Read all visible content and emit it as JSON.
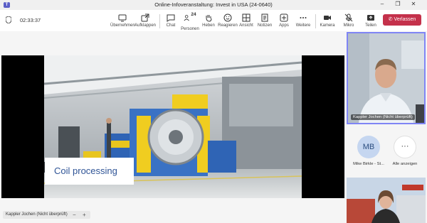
{
  "window": {
    "title": "Online-Infoveranstaltung: Invest in USA (24-0640)"
  },
  "meeting": {
    "timer": "02:33:37"
  },
  "toolbar": {
    "uebernehmen": "Übernehmen",
    "aufklappen": "Aufklappen",
    "chat": "Chat",
    "personen": "Personen",
    "personen_count": "24",
    "heben": "Heben",
    "reagieren": "Reagieren",
    "ansicht": "Ansicht",
    "notizen": "Notizen",
    "apps": "Apps",
    "weitere": "Weitere",
    "kamera": "Kamera",
    "mikro": "Mikro",
    "teilen": "Teilen",
    "verlassen": "Verlassen"
  },
  "stage": {
    "slide_title": "Coil processing",
    "presenter_label": "Kappler Jochen (Nicht überprüft)",
    "zoom_out": "−",
    "zoom_in": "+"
  },
  "participants": {
    "main_label": "Kappler Jochen (Nicht überprüft)",
    "avatar_initials": "MB",
    "avatar_name": "Mike Birkle - St...",
    "show_all": "Alle anzeigen",
    "more_glyph": "···"
  },
  "colors": {
    "accent": "#5b5fc7",
    "leave": "#c4314b",
    "speaker_border": "#7f85f5"
  }
}
